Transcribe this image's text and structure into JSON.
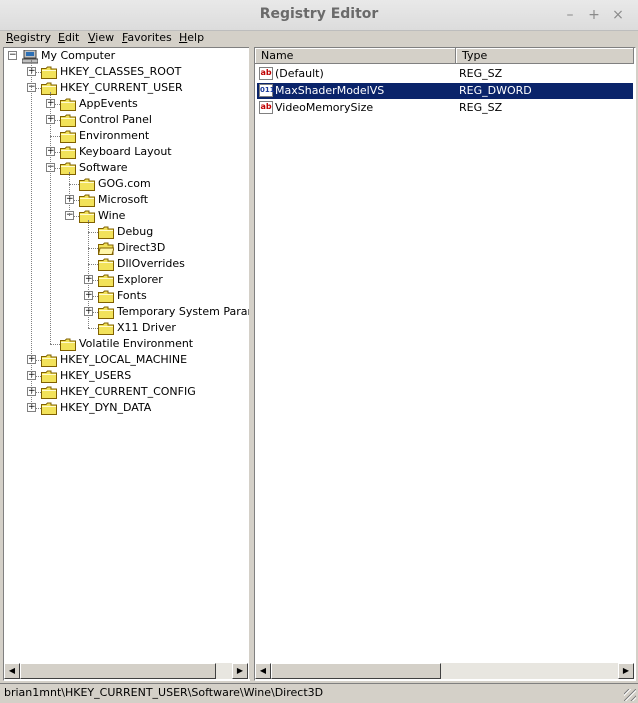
{
  "window": {
    "title": "Registry Editor",
    "minimize": "–",
    "maximize": "+",
    "close": "×"
  },
  "menu": [
    {
      "label": "Registry",
      "accel": "R",
      "rest": "egistry"
    },
    {
      "label": "Edit",
      "accel": "E",
      "rest": "dit"
    },
    {
      "label": "View",
      "accel": "V",
      "rest": "iew"
    },
    {
      "label": "Favorites",
      "accel": "F",
      "rest": "avorites"
    },
    {
      "label": "Help",
      "accel": "H",
      "rest": "elp"
    }
  ],
  "tree": [
    {
      "label": "My Computer",
      "level": 0,
      "expander": "-",
      "icon": "computer"
    },
    {
      "label": "HKEY_CLASSES_ROOT",
      "level": 1,
      "expander": "+"
    },
    {
      "label": "HKEY_CURRENT_USER",
      "level": 1,
      "expander": "-"
    },
    {
      "label": "AppEvents",
      "level": 2,
      "expander": "+"
    },
    {
      "label": "Control Panel",
      "level": 2,
      "expander": "+"
    },
    {
      "label": "Environment",
      "level": 2,
      "expander": ""
    },
    {
      "label": "Keyboard Layout",
      "level": 2,
      "expander": "+"
    },
    {
      "label": "Software",
      "level": 2,
      "expander": "-"
    },
    {
      "label": "GOG.com",
      "level": 3,
      "expander": ""
    },
    {
      "label": "Microsoft",
      "level": 3,
      "expander": "+"
    },
    {
      "label": "Wine",
      "level": 3,
      "expander": "-"
    },
    {
      "label": "Debug",
      "level": 4,
      "expander": ""
    },
    {
      "label": "Direct3D",
      "level": 4,
      "expander": "",
      "open": true
    },
    {
      "label": "DllOverrides",
      "level": 4,
      "expander": ""
    },
    {
      "label": "Explorer",
      "level": 4,
      "expander": "+"
    },
    {
      "label": "Fonts",
      "level": 4,
      "expander": "+"
    },
    {
      "label": "Temporary System Paramet",
      "level": 4,
      "expander": "+"
    },
    {
      "label": "X11 Driver",
      "level": 4,
      "expander": ""
    },
    {
      "label": "Volatile Environment",
      "level": 2,
      "expander": ""
    },
    {
      "label": "HKEY_LOCAL_MACHINE",
      "level": 1,
      "expander": "+"
    },
    {
      "label": "HKEY_USERS",
      "level": 1,
      "expander": "+"
    },
    {
      "label": "HKEY_CURRENT_CONFIG",
      "level": 1,
      "expander": "+"
    },
    {
      "label": "HKEY_DYN_DATA",
      "level": 1,
      "expander": "+"
    }
  ],
  "list": {
    "columns": {
      "name": "Name",
      "type": "Type"
    },
    "rows": [
      {
        "name": "(Default)",
        "type": "REG_SZ",
        "icon": "string-value-icon",
        "selected": false
      },
      {
        "name": "MaxShaderModelVS",
        "type": "REG_DWORD",
        "icon": "binary-value-icon",
        "selected": true
      },
      {
        "name": "VideoMemorySize",
        "type": "REG_SZ",
        "icon": "string-value-icon",
        "selected": false
      }
    ]
  },
  "status": {
    "path": "brian1mnt\\HKEY_CURRENT_USER\\Software\\Wine\\Direct3D"
  },
  "icons": {
    "string_glyph": "ab",
    "binary_glyph": "011"
  },
  "scroll": {
    "left_arrow": "◀",
    "right_arrow": "▶"
  },
  "colors": {
    "selection": "#0a246a",
    "folder": "#f2e25a"
  }
}
